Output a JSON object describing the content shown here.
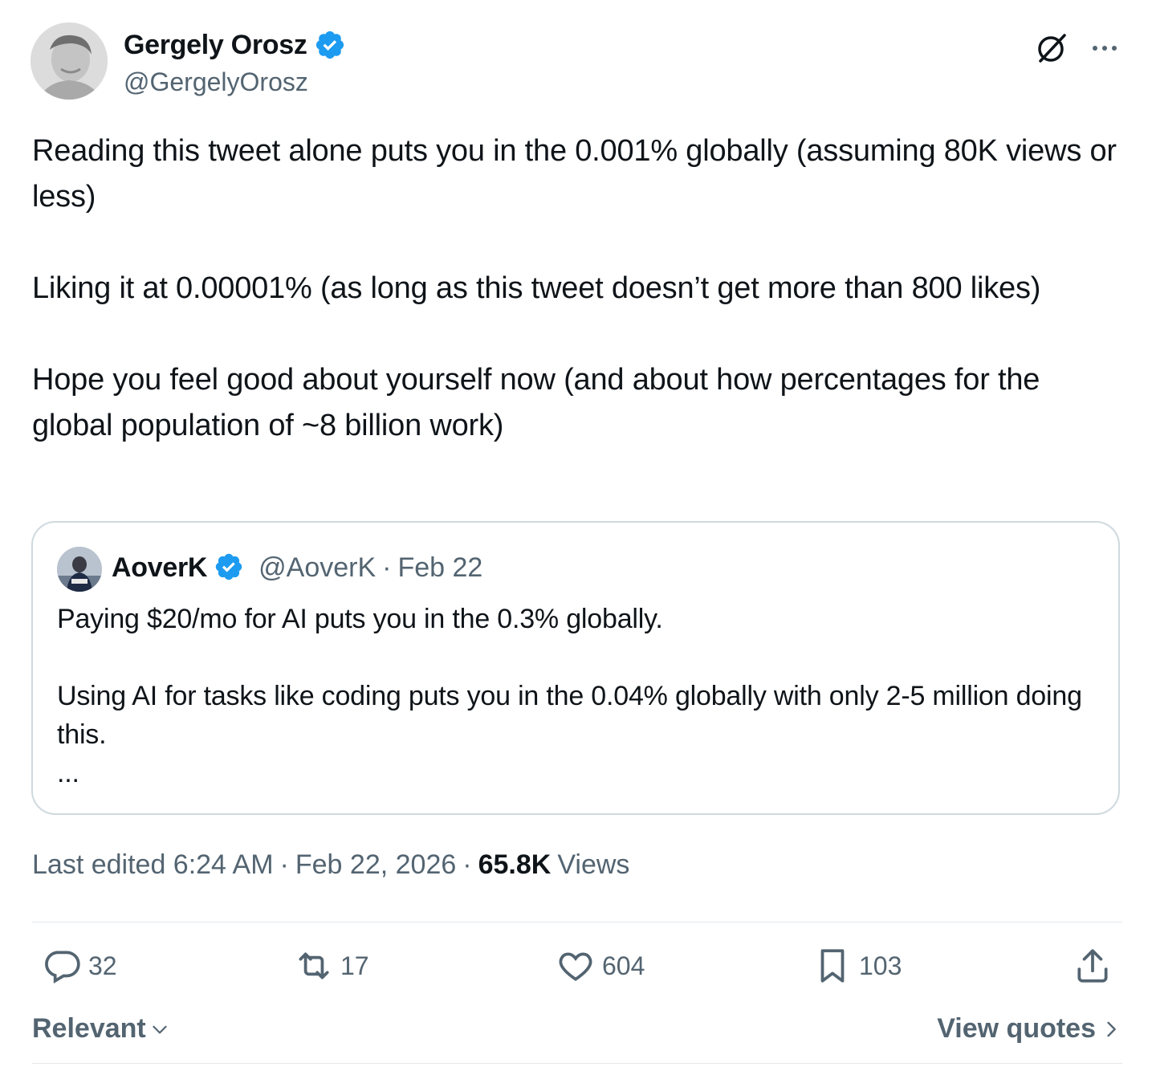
{
  "author": {
    "name": "Gergely Orosz",
    "handle": "@GergelyOrosz",
    "verified": true
  },
  "top_icons": [
    "grok-icon",
    "more-options-icon"
  ],
  "tweet_text": "Reading this tweet alone puts you in the 0.001% globally (assuming 80K views or less)\n\nLiking it at 0.00001% (as long as this tweet doesn’t get more than 800 likes)\n\nHope you feel good about yourself now (and about how percentages for the global population of ~8 billion work)",
  "quoted_tweet": {
    "name": "AoverK",
    "handle": "@AoverK",
    "separator": "·",
    "date": "Feb 22",
    "text": "Paying $20/mo for AI puts you in the 0.3% globally.\n\nUsing AI for tasks like coding puts you in the 0.04% globally with only 2-5 million doing this.\n...",
    "verified": true
  },
  "meta": {
    "edited_time": "Last edited 6:24 AM",
    "separator": "·",
    "date": "Feb 22, 2026",
    "views_count": "65.8K",
    "views_label": "Views"
  },
  "actions": {
    "replies": "32",
    "reposts": "17",
    "likes": "604",
    "bookmarks": "103"
  },
  "footer": {
    "sort_label": "Relevant",
    "view_quotes_label": "View quotes"
  },
  "colors": {
    "text_primary": "#0f1419",
    "text_secondary": "#536471",
    "verified_blue": "#1d9bf0",
    "border": "#cfd9de"
  }
}
